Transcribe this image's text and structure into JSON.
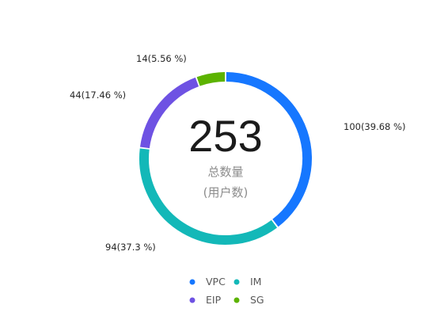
{
  "chart_data": {
    "type": "pie",
    "center_total": "253",
    "center_label_line1": "总数量",
    "center_label_line2": "(用户数)",
    "series": [
      {
        "name": "VPC",
        "value": 100,
        "percent_label": "100(39.68 %)",
        "color": "#1677ff"
      },
      {
        "name": "IM",
        "value": 94,
        "percent_label": "94(37.3 %)",
        "color": "#13b8b8"
      },
      {
        "name": "EIP",
        "value": 44,
        "percent_label": "44(17.46 %)",
        "color": "#6e52e3"
      },
      {
        "name": "SG",
        "value": 14,
        "percent_label": "14(5.56 %)",
        "color": "#5cb300"
      }
    ],
    "legend_placement": "bottom"
  }
}
